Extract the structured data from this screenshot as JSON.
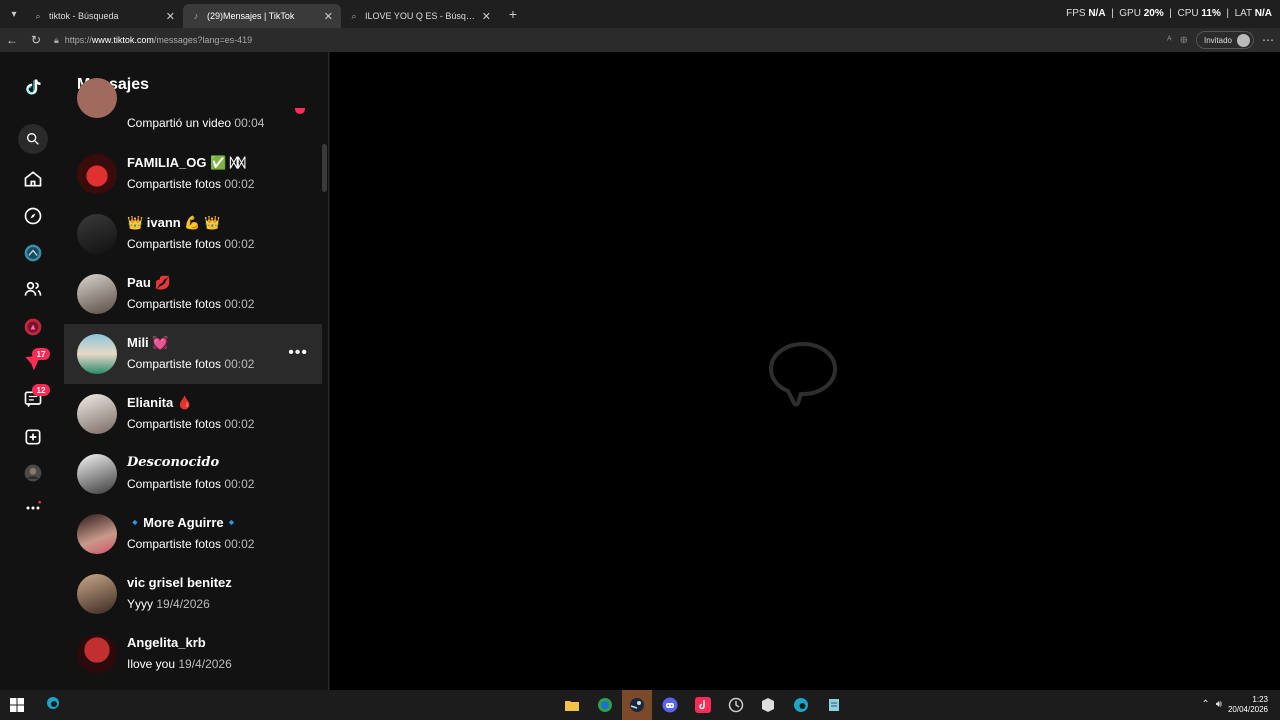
{
  "browser": {
    "tabs": [
      {
        "title": "tiktok - Búsqueda",
        "active": false,
        "icon": "search-icon"
      },
      {
        "title": "(29)Mensajes | TikTok",
        "active": true,
        "icon": "tiktok-icon"
      },
      {
        "title": "ILOVE YOU Q ES - Búsqueda",
        "active": false,
        "icon": "search-icon"
      }
    ],
    "perf": {
      "fps_label": "FPS",
      "fps_value": "N/A",
      "gpu_label": "GPU",
      "gpu_value": "20%",
      "cpu_label": "CPU",
      "cpu_value": "11%",
      "lat_label": "LAT",
      "lat_value": "N/A"
    },
    "url_prefix": "https://",
    "url_host": "www.tiktok.com",
    "url_path": "/messages?lang=es-419",
    "guest_label": "Invitado"
  },
  "leftnav": {
    "items": [
      {
        "name": "tiktok-logo-icon"
      },
      {
        "name": "search-icon"
      },
      {
        "name": "home-icon"
      },
      {
        "name": "explore-icon"
      },
      {
        "name": "following-icon"
      },
      {
        "name": "friends-icon"
      },
      {
        "name": "live-icon"
      },
      {
        "name": "activity-icon",
        "badge": "17"
      },
      {
        "name": "messages-icon",
        "badge": "12"
      },
      {
        "name": "upload-icon"
      },
      {
        "name": "profile-avatar-icon"
      },
      {
        "name": "more-icon"
      }
    ]
  },
  "messages": {
    "title": "Mensajes",
    "conversations": [
      {
        "name": "",
        "preview": "Compartió un video",
        "time": "00:04",
        "partial": true
      },
      {
        "name": "FAMILIA_OG ✅ ᛞᛞ",
        "preview": "Compartiste fotos",
        "time": "00:02"
      },
      {
        "name": "👑 ivann 💪 👑",
        "preview": "Compartiste fotos",
        "time": "00:02"
      },
      {
        "name": "Pau 💋",
        "preview": "Compartiste fotos",
        "time": "00:02"
      },
      {
        "name": "Mili 💓",
        "preview": "Compartiste fotos",
        "time": "00:02",
        "hover": true
      },
      {
        "name": "Elianita 🩸",
        "preview": "Compartiste fotos",
        "time": "00:02"
      },
      {
        "name": "𝑫𝒆𝒔𝒄𝒐𝒏𝒐𝒄𝒊𝒅𝒐",
        "preview": "Compartiste fotos",
        "time": "00:02"
      },
      {
        "name": "🔹More Aguirre🔹",
        "preview": "Compartiste fotos",
        "time": "00:02"
      },
      {
        "name": "vic grisel benitez",
        "preview": "Yyyy",
        "time": "19/4/2026"
      },
      {
        "name": "Angelita_krb",
        "preview": "Ilove you",
        "time": "19/4/2026"
      }
    ],
    "more_options": "•••"
  },
  "main": {
    "empty_state_icon": "chat-bubble-icon"
  },
  "taskbar": {
    "time": "1:23",
    "date": "20/04/2026"
  },
  "colors": {
    "accent": "#fe2c55",
    "background": "#121212",
    "hover": "#2a2a2a"
  }
}
